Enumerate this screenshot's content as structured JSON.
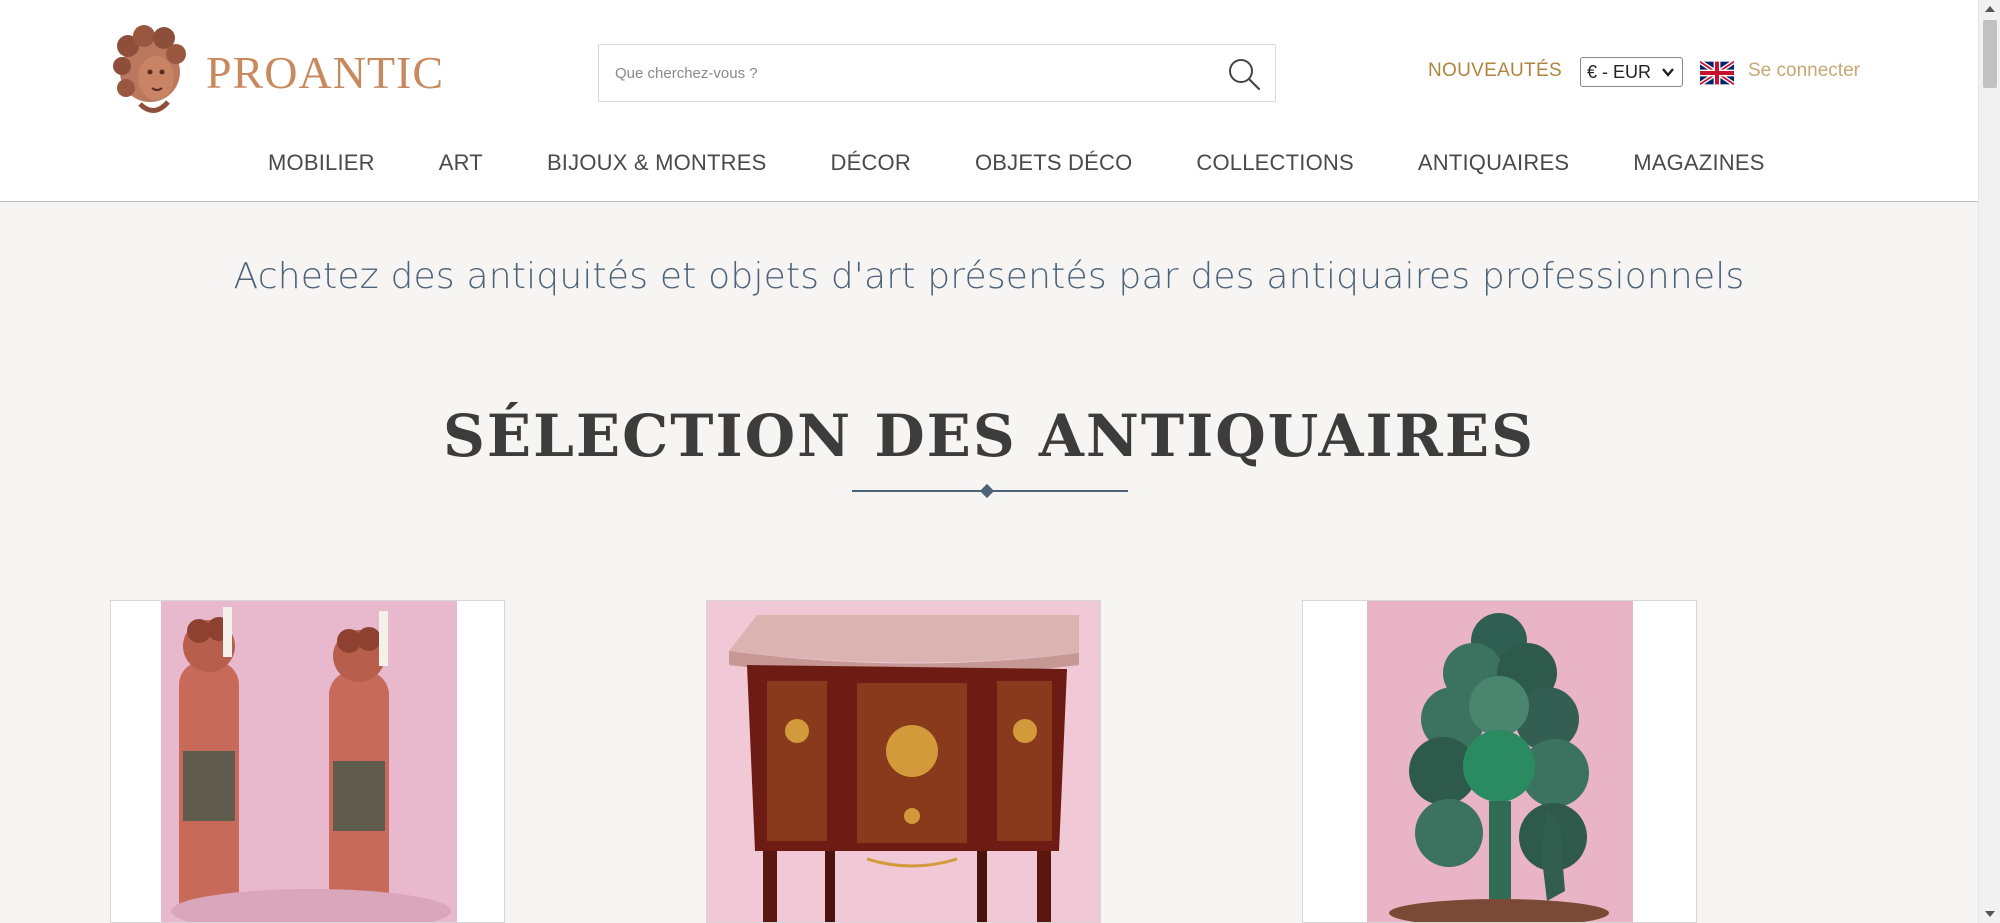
{
  "header": {
    "logo": {
      "text": "PROANTIC",
      "icon": "cherub-head-logo"
    },
    "search": {
      "placeholder": "Que cherchez-vous ?",
      "icon": "search-icon"
    },
    "nouveautes_label": "NOUVEAUTÉS",
    "currency": {
      "selected": "€ - EUR"
    },
    "language_flag": "uk-flag-icon",
    "login_label": "Se connecter"
  },
  "nav": {
    "items": [
      {
        "label": "MOBILIER"
      },
      {
        "label": "ART"
      },
      {
        "label": "BIJOUX & MONTRES"
      },
      {
        "label": "DÉCOR"
      },
      {
        "label": "OBJETS DÉCO"
      },
      {
        "label": "COLLECTIONS"
      },
      {
        "label": "ANTIQUAIRES"
      },
      {
        "label": "MAGAZINES"
      }
    ]
  },
  "main": {
    "tagline": "Achetez des antiquités et objets d'art présentés par des antiquaires professionnels",
    "section_title": "SÉLECTION DES ANTIQUAIRES",
    "products": [
      {
        "image": "pair-of-carved-wooden-angel-candle-holders"
      },
      {
        "image": "marquetry-commode-with-marble-top"
      },
      {
        "image": "green-glazed-ceramic-tree-sculpture"
      }
    ]
  },
  "colors": {
    "accent_gold": "#b0843e",
    "logo_copper": "#c9895f",
    "login_tan": "#c8a874",
    "tagline_slate": "#4f6378",
    "nav_text": "#4a4a4a"
  }
}
